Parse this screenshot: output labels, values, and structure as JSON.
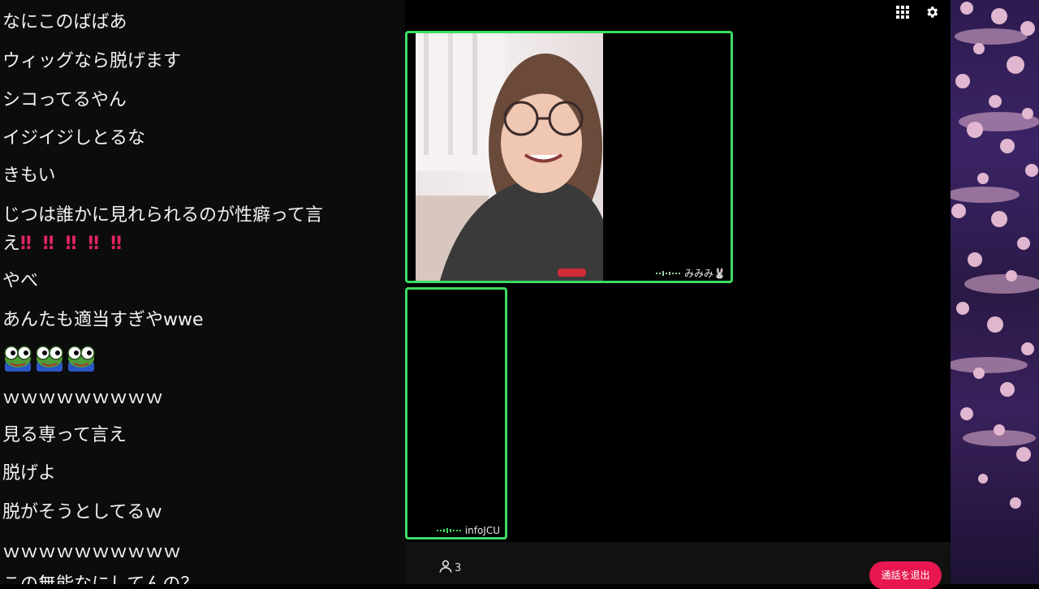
{
  "chat": {
    "messages": [
      "なにこのばばあ",
      "ウィッグなら脱げます",
      "シコってるやん",
      "イジイジしとるな",
      "きもい",
      "じつは誰かに見れられるのが性癖って言え",
      "やべ",
      "あんたも適当すぎやwwe",
      "ｗｗｗｗｗｗｗｗｗ",
      "見る専って言え",
      "脱げよ",
      "脱がそうとしてるｗ",
      "ｗｗｗｗｗｗｗｗｗｗ",
      "この無能なにしてんの？"
    ],
    "emphasis": "‼‼‼‼‼",
    "emoji_icon": "frog-emoji-icon"
  },
  "tiles": {
    "main": {
      "name": "みみみ🐰"
    },
    "second": {
      "name": "infoJCU"
    }
  },
  "controls": {
    "participant_count": "3",
    "leave_label": "通話を退出",
    "grid_icon": "grid-icon",
    "settings_icon": "gear-icon"
  },
  "colors": {
    "speaking_border": "#3ddc63",
    "leave_button": "#e8174f",
    "chat_bg": "#0c0c0c"
  }
}
